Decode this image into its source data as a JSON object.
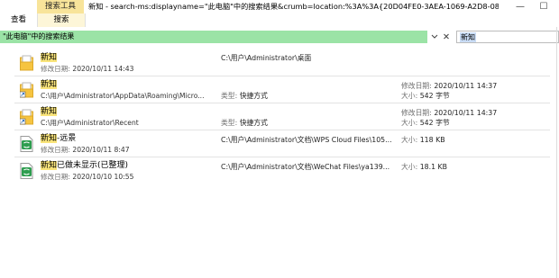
{
  "ribbon": {
    "contextual_tab": "搜索工具",
    "tabs": [
      "查看",
      "搜索"
    ]
  },
  "window": {
    "title": "新知 - search-ms:displayname=\"此电脑\"中的搜索结果&crumb=location:%3A%3A{20D04FE0-3AEA-1069-A2D8-08002B...",
    "controls": [
      "—",
      "☐"
    ]
  },
  "address": {
    "text": "\"此电脑\"中的搜索结果",
    "dropdown_icon": "chevron-down-icon",
    "clear_icon": "close-icon"
  },
  "search": {
    "value": "新知"
  },
  "labels": {
    "modified": "修改日期:",
    "type": "类型:",
    "size": "大小:"
  },
  "results": [
    {
      "name_hl": "新知",
      "name_rest": "",
      "icon": "folder-icon",
      "sub_label": "修改日期:",
      "sub_value": "2020/10/11 14:43",
      "col2_label": "",
      "col2_value": "C:\\用户\\Administrator\\桌面",
      "col3_line1_label": "",
      "col3_line1_value": "",
      "col3_line2_label": "",
      "col3_line2_value": ""
    },
    {
      "name_hl": "新知",
      "name_rest": "",
      "icon": "folder-shortcut-icon",
      "sub_label": "",
      "sub_value": "C:\\用户\\Administrator\\AppData\\Roaming\\Micro...",
      "col2_label": "类型:",
      "col2_value": "快捷方式",
      "col3_line1_label": "修改日期:",
      "col3_line1_value": "2020/10/11 14:37",
      "col3_line2_label": "大小:",
      "col3_line2_value": "542 字节"
    },
    {
      "name_hl": "新知",
      "name_rest": "",
      "icon": "folder-shortcut-icon",
      "sub_label": "",
      "sub_value": "C:\\用户\\Administrator\\Recent",
      "col2_label": "类型:",
      "col2_value": "快捷方式",
      "col3_line1_label": "修改日期:",
      "col3_line1_value": "2020/10/11 14:37",
      "col3_line2_label": "大小:",
      "col3_line2_value": "542 字节"
    },
    {
      "name_hl": "新知",
      "name_rest": "-远景",
      "icon": "wps-sheet-icon",
      "sub_label": "修改日期:",
      "sub_value": "2020/10/11 8:47",
      "col2_label": "",
      "col2_value": "C:\\用户\\Administrator\\文档\\WPS Cloud Files\\105...",
      "col3_line1_label": "大小:",
      "col3_line1_value": "118 KB",
      "col3_line2_label": "",
      "col3_line2_value": ""
    },
    {
      "name_hl": "新知",
      "name_rest": "已做未显示(已整理)",
      "icon": "wps-sheet-icon",
      "sub_label": "修改日期:",
      "sub_value": "2020/10/10 10:55",
      "col2_label": "",
      "col2_value": "C:\\用户\\Administrator\\文档\\WeChat Files\\ya139...",
      "col3_line1_label": "大小:",
      "col3_line1_value": "18.1 KB",
      "col3_line2_label": "",
      "col3_line2_value": ""
    }
  ],
  "colors": {
    "address_bar": "#9be3a6",
    "highlight": "#f9e47a",
    "ribbon_context": "#f8e49a",
    "sheet_icon": "#2e9d4f"
  }
}
